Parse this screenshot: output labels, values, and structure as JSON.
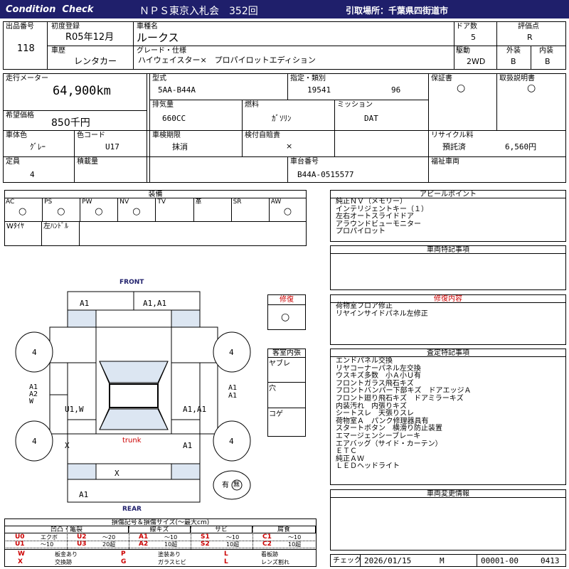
{
  "header": {
    "left_title": "Condition  Check",
    "center_title": "ＮＰＳ東京入札会　352回",
    "location": "引取場所：千葉県四街道市"
  },
  "top": {
    "lot_label": "出品番号",
    "lot_value": "118",
    "first_reg_label": "初度登録",
    "first_reg_value": "R05年12月",
    "car_name_label": "車種名",
    "car_name_value": "ルークス",
    "doors_label": "ドア数",
    "doors_value": "5",
    "grade_score_label": "評価点",
    "grade_score_value": "R",
    "history_label": "車歴",
    "history_value": "レンタカー",
    "grade_label": "グレード・仕様",
    "grade_value": "ハイウェイスター×　プロパイロットエディション",
    "drive_label": "駆動",
    "drive_value": "2WD",
    "exterior_label": "外装",
    "exterior_value": "B",
    "interior_label": "内装",
    "interior_value": "B"
  },
  "specs": {
    "mileage_label": "走行メーター",
    "mileage_value": "64,900km",
    "model_label": "型式",
    "model_value": "5AA-B44A",
    "designation_label": "指定・類別",
    "designation_value": "19541",
    "category_value": "96",
    "warranty_label": "保証書",
    "warranty_value": "○",
    "manual_label": "取扱説明書",
    "manual_value": "○",
    "price_label": "希望価格",
    "price_value": "850千円",
    "displacement_label": "排気量",
    "displacement_value": "660CC",
    "fuel_label": "燃料",
    "fuel_value": "ｶﾞｿﾘﾝ",
    "mission_label": "ミッション",
    "mission_value": "DAT",
    "body_color_label": "車体色",
    "body_color_value": "ｸﾞﾚｰ",
    "color_code_label": "色コード",
    "color_code_value": "U17",
    "inspection_label": "車検期限",
    "inspection_value": "抹消",
    "insurance_label": "検付自賠責",
    "insurance_value": "×",
    "recycle_label": "リサイクル料",
    "recycle_status": "預託済",
    "recycle_value": "6,560円",
    "capacity_label": "定員",
    "capacity_value": "4",
    "load_label": "積載量",
    "load_value": "",
    "chassis_label": "車台番号",
    "chassis_value": "B44A-0515577",
    "welfare_label": "福祉車両",
    "welfare_value": ""
  },
  "equipment": {
    "title": "装備",
    "cells": [
      {
        "label": "AC",
        "mark": "○"
      },
      {
        "label": "PS",
        "mark": "○"
      },
      {
        "label": "PW",
        "mark": "○"
      },
      {
        "label": "NV",
        "mark": "○"
      },
      {
        "label": "TV",
        "mark": ""
      },
      {
        "label": "革",
        "mark": ""
      },
      {
        "label": "SR",
        "mark": ""
      },
      {
        "label": "AW",
        "mark": "○"
      }
    ],
    "row2": [
      {
        "label": "Wﾀｲﾔ"
      },
      {
        "label": "左ﾊﾝﾄﾞﾙ"
      }
    ]
  },
  "appeal": {
    "title": "アピールポイント",
    "lines": [
      "純正ＮＶ（メモリー）",
      "インテリジェントキー（１）",
      "左右オートスライドドア",
      "アラウンドビューモニター",
      "プロパイロット"
    ]
  },
  "special_notes": {
    "title": "車両特記事項"
  },
  "repair": {
    "title": "修復",
    "mark": "○"
  },
  "repair_details": {
    "title": "修復内容",
    "lines": [
      "荷物室フロア修正",
      "リヤインサイドパネル左修正"
    ]
  },
  "interior_condition": {
    "title": "客室内張",
    "rows": [
      "ヤブレ",
      "穴",
      "コゲ"
    ]
  },
  "inspector_notes": {
    "title": "査定特記事項",
    "lines": [
      "エンドパネル交換",
      "リヤコーナーパネル左交換",
      "ウスキズ多数　小Ａ小Ｕ有",
      "フロントガラス飛石キズ",
      "フロントバンパー下部キズ　ドアエッジＡ",
      "フロント廻り飛石キズ　ドアミラーキズ",
      "内装汚れ　内張りキズ",
      "シートスレ　天張りスレ",
      "荷物室Ａ　パンク修理器具有",
      "スタートボタン　横滑り防止装置",
      "エマージェンシーブレーキ",
      "エアバッグ（サイド・カーテン）",
      "ＥＴＣ",
      "純正ＡＷ",
      "ＬＥＤヘッドライト"
    ]
  },
  "changes": {
    "title": "車両変更情報"
  },
  "diagram": {
    "front_label": "FRONT",
    "rear_label": "REAR",
    "trunk_label": "trunk",
    "front_left": "A1",
    "front_right": "A1,A1",
    "tire_fl": "4",
    "tire_fr": "4",
    "tire_rl": "4",
    "tire_rr": "4",
    "left_side": "A1\nA2\nW",
    "right_side": "A1\nA1",
    "left_door": "U1,W",
    "right_door": "A1,A1",
    "left_rear": "X",
    "right_rear": "A1",
    "rear_center": "X",
    "rear_bottom": "A1",
    "spare_label": "有",
    "spare_mark": "無"
  },
  "legend": {
    "title": "損傷記号＆損傷サイズ(〜最大cm)",
    "columns": [
      "凹凸・亀裂",
      "線キズ",
      "サビ",
      "腐食"
    ],
    "rows": [
      [
        [
          "U0",
          "エクボ"
        ],
        [
          "U2",
          "〜20"
        ],
        [
          "A1",
          "〜10"
        ],
        [
          "S1",
          "〜10"
        ],
        [
          "C1",
          "〜10"
        ]
      ],
      [
        [
          "U1",
          "〜10"
        ],
        [
          "U3",
          "20超"
        ],
        [
          "A2",
          "10超"
        ],
        [
          "S2",
          "10超"
        ],
        [
          "C2",
          "10超"
        ]
      ]
    ],
    "bottom": [
      [
        [
          "W",
          "板金あり"
        ],
        [
          "P",
          "塗装あり"
        ],
        [
          "L",
          "看板跡"
        ]
      ],
      [
        [
          "X",
          "交換跡"
        ],
        [
          "G",
          "ガラスヒビ"
        ],
        [
          "L",
          "レンズ割れ"
        ]
      ]
    ]
  },
  "footer": {
    "check_label": "チェック",
    "date": "2026/01/15",
    "mark": "M",
    "code": "00001-00",
    "number": "0413"
  }
}
